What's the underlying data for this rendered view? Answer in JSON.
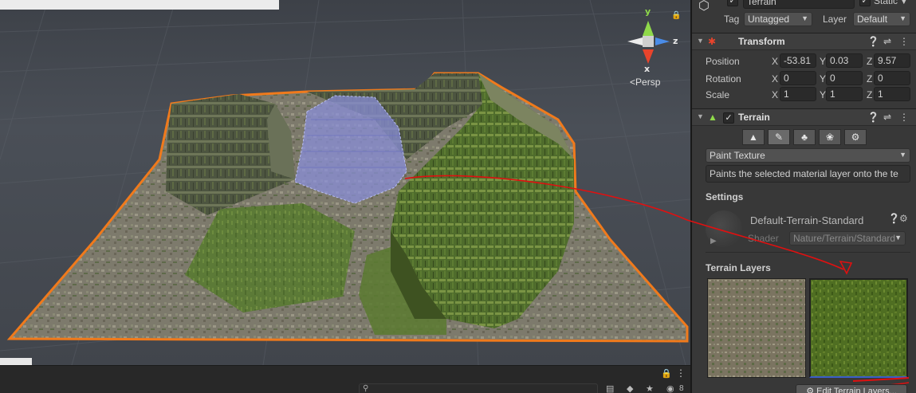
{
  "scene": {
    "gizmo": {
      "y_label": "y",
      "x_label": "x",
      "z_label": "z"
    },
    "projection_label": "Persp",
    "toolbar": {
      "hidden_count": "8"
    }
  },
  "inspector": {
    "object": {
      "name": "Terrain",
      "static_label": "Static",
      "tag_label": "Tag",
      "tag_value": "Untagged",
      "layer_label": "Layer",
      "layer_value": "Default"
    },
    "transform": {
      "title": "Transform",
      "position_label": "Position",
      "rotation_label": "Rotation",
      "scale_label": "Scale",
      "axis_x": "X",
      "axis_y": "Y",
      "axis_z": "Z",
      "position": {
        "x": "-53.81",
        "y": "0.03",
        "z": "9.57"
      },
      "rotation": {
        "x": "0",
        "y": "0",
        "z": "0"
      },
      "scale": {
        "x": "1",
        "y": "1",
        "z": "1"
      }
    },
    "terrain": {
      "title": "Terrain",
      "mode_value": "Paint Texture",
      "description": "Paints the selected material layer onto the te",
      "settings_label": "Settings",
      "material_name": "Default-Terrain-Standard",
      "shader_label": "Shader",
      "shader_value": "Nature/Terrain/Standard",
      "layers_label": "Terrain Layers",
      "edit_layers_label": "Edit Terrain Layers..."
    }
  },
  "colors": {
    "selection_outline": "#f07a1c",
    "annotation_red": "#e01010",
    "gizmo_y": "#8fd94a",
    "gizmo_x": "#e8442c",
    "gizmo_z": "#4a8ce8"
  }
}
